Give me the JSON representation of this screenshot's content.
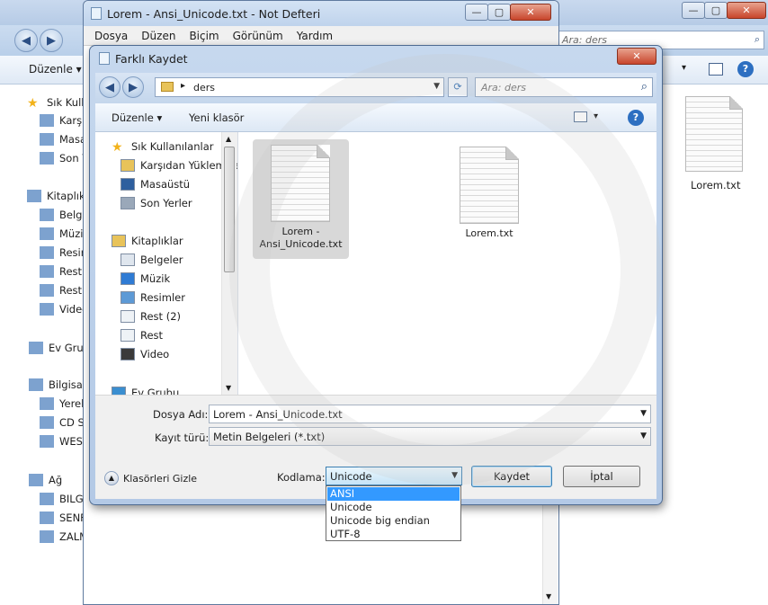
{
  "explorer": {
    "nav_buttons": [
      "back",
      "forward"
    ],
    "search_placeholder": "Ara: ders",
    "toolbar": {
      "organize_label": "Düzenle"
    },
    "sidebar": [
      {
        "label": "Sık Kullanılanlar",
        "icon": "star-icon"
      },
      {
        "label": "Karşıdan Yüklemeler",
        "icon": "folder-download-icon"
      },
      {
        "label": "Masaüstü",
        "icon": "desktop-icon"
      },
      {
        "label": "Son Yerler",
        "icon": "recent-places-icon"
      },
      {
        "label": "Kitaplıklar",
        "icon": "libraries-icon"
      },
      {
        "label": "Belgeler",
        "icon": "documents-icon"
      },
      {
        "label": "Müzik",
        "icon": "music-icon"
      },
      {
        "label": "Resimler",
        "icon": "pictures-icon"
      },
      {
        "label": "Rest",
        "icon": "document-icon"
      },
      {
        "label": "Rest",
        "icon": "document-icon"
      },
      {
        "label": "Video",
        "icon": "video-icon"
      },
      {
        "label": "Ev Grubu",
        "icon": "homegroup-icon"
      },
      {
        "label": "Bilgisayar",
        "icon": "computer-icon"
      },
      {
        "label": "Yerel Disk",
        "icon": "disk-icon"
      },
      {
        "label": "CD Sürücüsü",
        "icon": "cd-icon"
      },
      {
        "label": "WEST",
        "icon": "drive-icon"
      },
      {
        "label": "Ağ",
        "icon": "network-icon"
      },
      {
        "label": "BILGISAYAR",
        "icon": "network-computer-icon"
      },
      {
        "label": "SENF",
        "icon": "network-computer-icon"
      },
      {
        "label": "ZALM",
        "icon": "network-computer-icon"
      }
    ],
    "file": {
      "name": "Lorem.txt"
    }
  },
  "notepad": {
    "title": "Lorem - Ansi_Unicode.txt - Not Defteri",
    "menu": [
      "Dosya",
      "Düzen",
      "Biçim",
      "Görünüm",
      "Yardım"
    ]
  },
  "dialog": {
    "title": "Farklı Kaydet",
    "address": {
      "crumb": "ders"
    },
    "search_placeholder": "Ara: ders",
    "toolbar": {
      "organize_label": "Düzenle",
      "new_folder_label": "Yeni klasör"
    },
    "nav": [
      {
        "label": "Sık Kullanılanlar",
        "icon": "star-icon",
        "level": 0
      },
      {
        "label": "Karşıdan Yüklemeler",
        "icon": "folder-download-icon",
        "level": 1
      },
      {
        "label": "Masaüstü",
        "icon": "desktop-icon",
        "level": 1
      },
      {
        "label": "Son Yerler",
        "icon": "recent-places-icon",
        "level": 1
      },
      {
        "label": "Kitaplıklar",
        "icon": "libraries-icon",
        "level": 0
      },
      {
        "label": "Belgeler",
        "icon": "documents-icon",
        "level": 1
      },
      {
        "label": "Müzik",
        "icon": "music-icon",
        "level": 1
      },
      {
        "label": "Resimler",
        "icon": "pictures-icon",
        "level": 1
      },
      {
        "label": "Rest (2)",
        "icon": "document-icon",
        "level": 1
      },
      {
        "label": "Rest",
        "icon": "document-icon",
        "level": 1
      },
      {
        "label": "Video",
        "icon": "video-icon",
        "level": 1
      },
      {
        "label": "Ev Grubu",
        "icon": "homegroup-icon",
        "level": 0
      }
    ],
    "files": [
      {
        "name_line1": "Lorem -",
        "name_line2": "Ansi_Unicode.txt",
        "selected": true
      },
      {
        "name_line1": "Lorem.txt",
        "name_line2": "",
        "selected": false
      }
    ],
    "filename_label": "Dosya Adı:",
    "filename_value": "Lorem - Ansi_Unicode.txt",
    "filetype_label": "Kayıt türü:",
    "filetype_value": "Metin Belgeleri (*.txt)",
    "hide_folders_label": "Klasörleri Gizle",
    "encoding_label": "Kodlama:",
    "encoding_value": "Unicode",
    "encoding_options": [
      "ANSI",
      "Unicode",
      "Unicode big endian",
      "UTF-8"
    ],
    "encoding_highlighted": "ANSI",
    "save_label": "Kaydet",
    "cancel_label": "İptal"
  },
  "colors": {
    "selection": "#3399ff",
    "titlebar": "#c4d6ec",
    "accent_link": "#1e3e73"
  }
}
